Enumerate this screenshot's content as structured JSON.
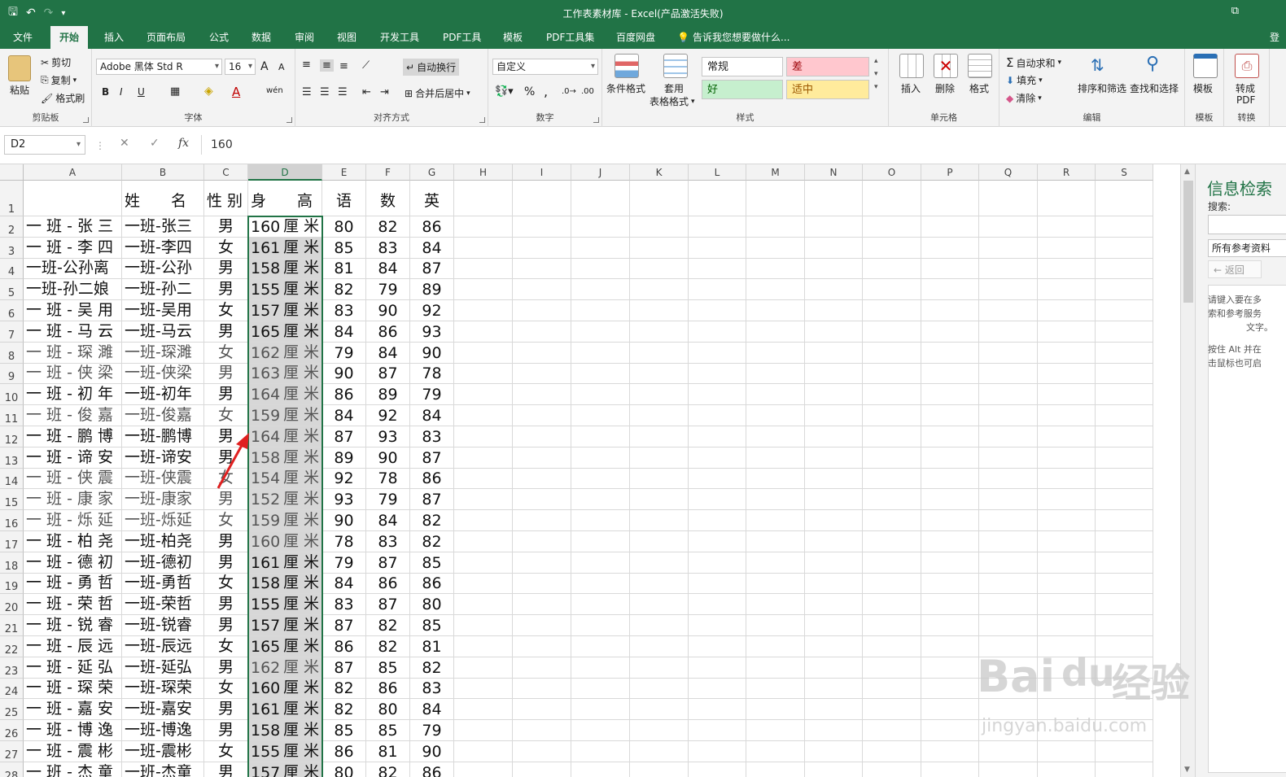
{
  "window": {
    "title": "工作表素材库 - Excel(产品激活失败)",
    "restore_glyph": "⧉"
  },
  "qat": {
    "save": "🖫",
    "undo": "↶",
    "redo": "↷",
    "customize": "▾"
  },
  "tabs": [
    {
      "label": "文件"
    },
    {
      "label": "开始"
    },
    {
      "label": "插入"
    },
    {
      "label": "页面布局"
    },
    {
      "label": "公式"
    },
    {
      "label": "数据"
    },
    {
      "label": "审阅"
    },
    {
      "label": "视图"
    },
    {
      "label": "开发工具"
    },
    {
      "label": "PDF工具"
    },
    {
      "label": "模板"
    },
    {
      "label": "PDF工具集"
    },
    {
      "label": "百度网盘"
    }
  ],
  "tell_me": "告诉我您想要做什么...",
  "account": "登",
  "ribbon": {
    "clipboard": {
      "label": "剪贴板",
      "paste": "粘贴",
      "cut": "剪切",
      "copy": "复制",
      "format_painter": "格式刷"
    },
    "font": {
      "label": "字体",
      "font_name": "Adobe 黑体 Std R",
      "font_size": "16",
      "bold": "B",
      "italic": "I",
      "underline": "U",
      "grow": "A",
      "shrink": "A",
      "font_color": "A",
      "phonetic": "wén"
    },
    "alignment": {
      "label": "对齐方式",
      "wrap": "自动换行",
      "merge": "合并后居中"
    },
    "number": {
      "label": "数字",
      "format": "自定义",
      "percent": "%",
      "comma": ","
    },
    "styles": {
      "label": "样式",
      "conditional": "条件格式",
      "table": "套用",
      "table2": "表格格式",
      "normal": "常规",
      "bad": "差",
      "good": "好",
      "neutral": "适中"
    },
    "cells": {
      "label": "单元格",
      "insert": "插入",
      "delete": "删除",
      "format": "格式"
    },
    "editing": {
      "label": "编辑",
      "autosum": "自动求和",
      "fill": "填充",
      "clear": "清除",
      "sort": "排序和筛选",
      "find": "查找和选择"
    },
    "template": {
      "label": "模板",
      "btn": "模板"
    },
    "convert": {
      "label": "转换",
      "btn": "转成",
      "btn2": "PDF"
    }
  },
  "formula_bar": {
    "name_box": "D2",
    "cancel": "✕",
    "enter": "✓",
    "fx": "fx",
    "value": "160"
  },
  "columns": [
    "A",
    "B",
    "C",
    "D",
    "E",
    "F",
    "G",
    "H",
    "I",
    "J",
    "K",
    "L",
    "M",
    "N",
    "O",
    "P",
    "Q",
    "R",
    "S"
  ],
  "header_row": {
    "B": "姓　　名",
    "C": "性 别",
    "D": "身　　高",
    "E": "语",
    "F": "数",
    "G": "英"
  },
  "rows": [
    {
      "a": "一 班 - 张 三",
      "b": "一班-张三",
      "c": "男",
      "h": "160",
      "e": "80",
      "f": "82",
      "g": "86"
    },
    {
      "a": "一 班 - 李 四",
      "b": "一班-李四",
      "c": "女",
      "h": "161",
      "e": "85",
      "f": "83",
      "g": "84"
    },
    {
      "a": "一班-公孙离",
      "b": "一班-公孙",
      "c": "男",
      "h": "158",
      "e": "81",
      "f": "84",
      "g": "87"
    },
    {
      "a": "一班-孙二娘",
      "b": "一班-孙二",
      "c": "男",
      "h": "155",
      "e": "82",
      "f": "79",
      "g": "89"
    },
    {
      "a": "一 班 - 吴 用",
      "b": "一班-吴用",
      "c": "女",
      "h": "157",
      "e": "83",
      "f": "90",
      "g": "92"
    },
    {
      "a": "一 班 - 马 云",
      "b": "一班-马云",
      "c": "男",
      "h": "165",
      "e": "84",
      "f": "86",
      "g": "93"
    },
    {
      "a": "一 班 - 琛 濉",
      "b": "一班-琛濉",
      "c": "女",
      "h": "162",
      "e": "79",
      "f": "84",
      "g": "90"
    },
    {
      "a": "一 班 - 侠 梁",
      "b": "一班-侠梁",
      "c": "男",
      "h": "163",
      "e": "90",
      "f": "87",
      "g": "78"
    },
    {
      "a": "一 班 - 初 年",
      "b": "一班-初年",
      "c": "男",
      "h": "164",
      "e": "86",
      "f": "89",
      "g": "79"
    },
    {
      "a": "一 班 - 俊 嘉",
      "b": "一班-俊嘉",
      "c": "女",
      "h": "159",
      "e": "84",
      "f": "92",
      "g": "84"
    },
    {
      "a": "一 班 - 鹏 博",
      "b": "一班-鹏博",
      "c": "男",
      "h": "164",
      "e": "87",
      "f": "93",
      "g": "83"
    },
    {
      "a": "一 班 - 谛 安",
      "b": "一班-谛安",
      "c": "男",
      "h": "158",
      "e": "89",
      "f": "90",
      "g": "87"
    },
    {
      "a": "一 班 - 侠 震",
      "b": "一班-侠震",
      "c": "女",
      "h": "154",
      "e": "92",
      "f": "78",
      "g": "86"
    },
    {
      "a": "一 班 - 康 家",
      "b": "一班-康家",
      "c": "男",
      "h": "152",
      "e": "93",
      "f": "79",
      "g": "87"
    },
    {
      "a": "一 班 - 烁 延",
      "b": "一班-烁延",
      "c": "女",
      "h": "159",
      "e": "90",
      "f": "84",
      "g": "82"
    },
    {
      "a": "一 班 - 柏 尧",
      "b": "一班-柏尧",
      "c": "男",
      "h": "160",
      "e": "78",
      "f": "83",
      "g": "82"
    },
    {
      "a": "一 班 - 德 初",
      "b": "一班-德初",
      "c": "男",
      "h": "161",
      "e": "79",
      "f": "87",
      "g": "85"
    },
    {
      "a": "一 班 - 勇 哲",
      "b": "一班-勇哲",
      "c": "女",
      "h": "158",
      "e": "84",
      "f": "86",
      "g": "86"
    },
    {
      "a": "一 班 - 荣 哲",
      "b": "一班-荣哲",
      "c": "男",
      "h": "155",
      "e": "83",
      "f": "87",
      "g": "80"
    },
    {
      "a": "一 班 - 锐 睿",
      "b": "一班-锐睿",
      "c": "男",
      "h": "157",
      "e": "87",
      "f": "82",
      "g": "85"
    },
    {
      "a": "一 班 - 辰 远",
      "b": "一班-辰远",
      "c": "女",
      "h": "165",
      "e": "86",
      "f": "82",
      "g": "81"
    },
    {
      "a": "一 班 - 延 弘",
      "b": "一班-延弘",
      "c": "男",
      "h": "162",
      "e": "87",
      "f": "85",
      "g": "82"
    },
    {
      "a": "一 班 - 琛 荣",
      "b": "一班-琛荣",
      "c": "女",
      "h": "160",
      "e": "82",
      "f": "86",
      "g": "83"
    },
    {
      "a": "一 班 - 嘉 安",
      "b": "一班-嘉安",
      "c": "男",
      "h": "161",
      "e": "82",
      "f": "80",
      "g": "84"
    },
    {
      "a": "一 班 - 博 逸",
      "b": "一班-博逸",
      "c": "男",
      "h": "158",
      "e": "85",
      "f": "85",
      "g": "79"
    },
    {
      "a": "一 班 - 震 彬",
      "b": "一班-震彬",
      "c": "女",
      "h": "155",
      "e": "86",
      "f": "81",
      "g": "90"
    },
    {
      "a": "一 班 - 杰 童",
      "b": "一班-杰童",
      "c": "男",
      "h": "157",
      "e": "80",
      "f": "82",
      "g": "86"
    }
  ],
  "height_unit": "厘 米",
  "research_pane": {
    "title": "信息检索",
    "search_label": "搜索:",
    "source": "所有参考资料",
    "back": "← 返回",
    "help_lines": [
      "请键入要在多",
      "索和参考服务",
      "文字。"
    ],
    "help_lines2": [
      "按住 Alt 并在",
      "击鼠标也可启"
    ]
  },
  "watermark": {
    "brand": "Bai",
    "brand2": "du",
    "brand3": "经验",
    "url": "jingyan.baidu.com"
  }
}
